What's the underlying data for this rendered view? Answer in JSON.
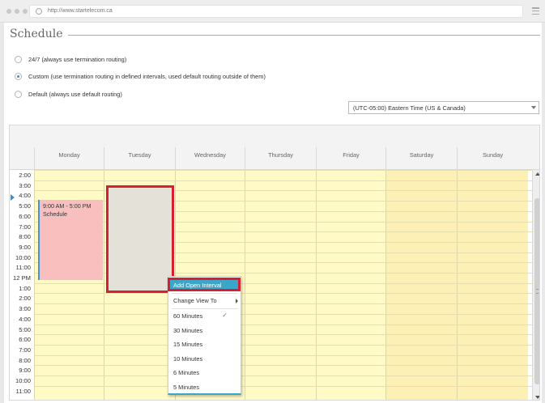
{
  "browser": {
    "url": "http://www.startelecom.ca"
  },
  "page": {
    "title": "Schedule"
  },
  "routing_options": [
    {
      "label": "24/7 (always use termination routing)",
      "selected": false
    },
    {
      "label": "Custom (use termination routing in defined intervals, used default routing outside of them)",
      "selected": true
    },
    {
      "label": "Default (always use default routing)",
      "selected": false
    }
  ],
  "timezone": {
    "selected": "(UTC-05:00) Eastern Time (US & Canada)"
  },
  "calendar": {
    "days": [
      "Monday",
      "Tuesday",
      "Wednesday",
      "Thursday",
      "Friday",
      "Saturday",
      "Sunday"
    ],
    "times": [
      "2:00",
      "3:00",
      "4:00",
      "5:00",
      "6:00",
      "7:00",
      "8:00",
      "9:00",
      "10:00",
      "11:00",
      "12 PM",
      "1:00",
      "2:00",
      "3:00",
      "4:00",
      "5:00",
      "6:00",
      "7:00",
      "8:00",
      "9:00",
      "10:00",
      "11:00"
    ],
    "event": {
      "time": "9:00 AM - 5:00 PM",
      "title": "Schedule"
    }
  },
  "context_menu": {
    "add_interval": "Add Open Interval",
    "change_view": "Change View To",
    "options": [
      "60 Minutes",
      "30 Minutes",
      "15 Minutes",
      "10 Minutes",
      "6 Minutes",
      "5 Minutes"
    ],
    "checked_index": 0,
    "check_glyph": "✓"
  },
  "colors": {
    "accent": "#3aa6c8",
    "highlight_border": "#d6202f",
    "weekday_bg": "#fffac6",
    "weekend_bg": "#fdf0b4",
    "event_bg": "#f9bfbf"
  }
}
